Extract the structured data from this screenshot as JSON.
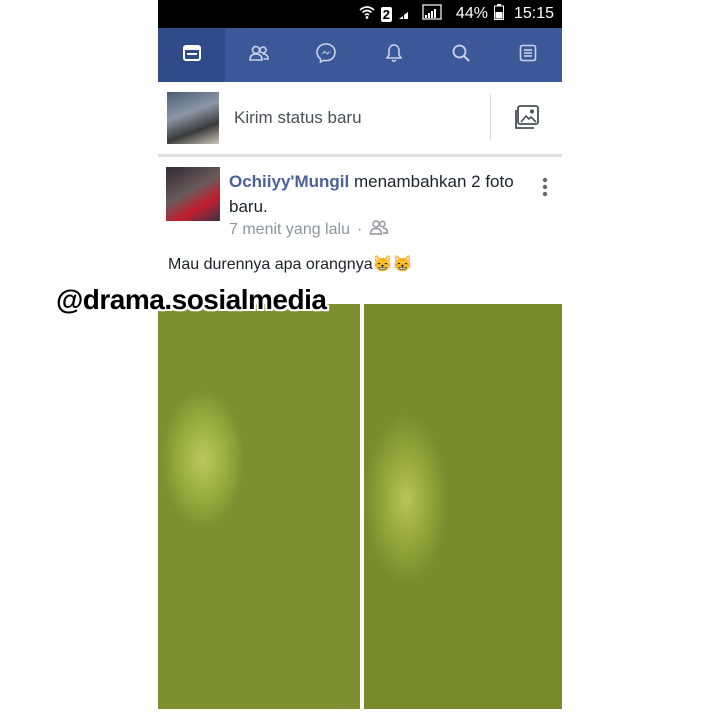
{
  "status_bar": {
    "sim_badge": "2",
    "battery": "44%",
    "time": "15:15"
  },
  "nav": {
    "tabs": [
      {
        "icon": "news-feed-icon",
        "active": true
      },
      {
        "icon": "friends-icon",
        "active": false
      },
      {
        "icon": "messenger-icon",
        "active": false
      },
      {
        "icon": "notifications-bell-icon",
        "active": false
      },
      {
        "icon": "search-icon",
        "active": false
      },
      {
        "icon": "menu-icon",
        "active": false
      }
    ]
  },
  "composer": {
    "placeholder": "Kirim status baru",
    "photo_icon": "photo-icon"
  },
  "post": {
    "author": "Ochiiyy'Mungil",
    "action": " menambahkan 2 foto baru.",
    "time": "7 menit yang lalu",
    "separator": "·",
    "audience_icon": "friends-audience-icon",
    "text": "Mau durennya apa orangnya😸😸",
    "photos": [
      "photo-1",
      "photo-2"
    ]
  },
  "watermark": "@drama.sosialmedia",
  "colors": {
    "brand_blue": "#3b5998",
    "author_blue": "#4b6199",
    "meta_gray": "#90949c"
  }
}
